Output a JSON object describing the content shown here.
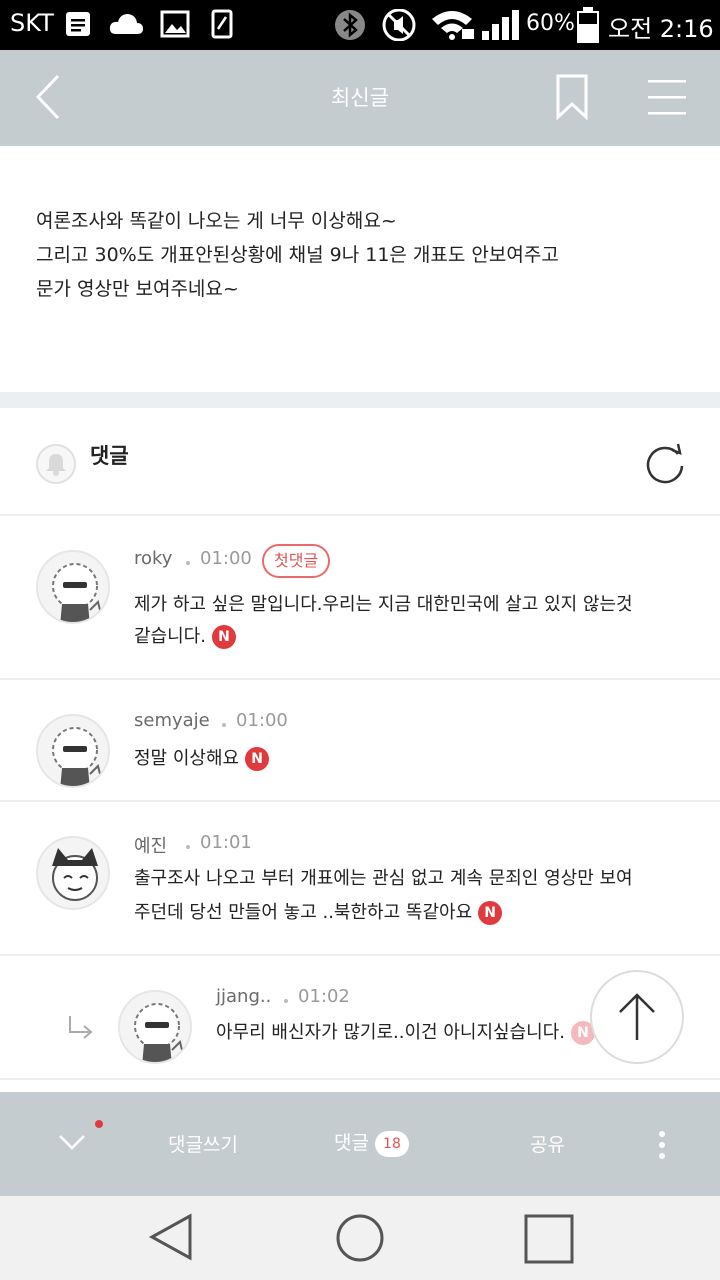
{
  "status_bar": {
    "carrier": "SKT",
    "battery": "60%",
    "time": "오전 2:16"
  },
  "header": {
    "title": "최신글",
    "icons": [
      "back-icon",
      "bookmark-icon",
      "menu-icon"
    ]
  },
  "post": {
    "lines": [
      "여론조사와 똑같이 나오는 게  너무 이상해요~",
      "그리고  30%도 개표안된상황에  채널 9나  11은  개표도 안보여주고",
      "문가  영상만 보여주네요~"
    ]
  },
  "comments_header": {
    "label": "댓글",
    "icons": [
      "bell-icon",
      "refresh-icon"
    ]
  },
  "comments": [
    {
      "nick": "roky",
      "time": "01:00",
      "badge": "첫댓글",
      "lines": [
        "제가 하고 싶은 말입니다.우리는 지금 대한민국에 살고 있지 않는것",
        "같습니다."
      ],
      "new": "N"
    },
    {
      "nick": "semyaje",
      "time": "01:00",
      "lines": [
        "정말 이상해요"
      ],
      "new": "N"
    },
    {
      "nick": "예진",
      "time": "01:01",
      "lines": [
        "출구조사 나오고 부터 개표에는 관심 없고 계속 문죄인 영상만 보여",
        "주던데 당선 만들어 놓고 ..북한하고 똑같아요"
      ],
      "new": "N"
    },
    {
      "nick": "jjang..",
      "time": "01:02",
      "lines": [
        "아무리 배신자가 많기로..이건 아니지싶습니다."
      ],
      "new": "N",
      "is_reply": true
    }
  ],
  "bottom_bar": {
    "write": "댓글쓰기",
    "comments": "댓글",
    "comment_count": "18",
    "share": "공유"
  },
  "colors": {
    "header_bg": "#c5cccf",
    "accent_red": "#e03a3e",
    "badge_red": "#e35555"
  }
}
